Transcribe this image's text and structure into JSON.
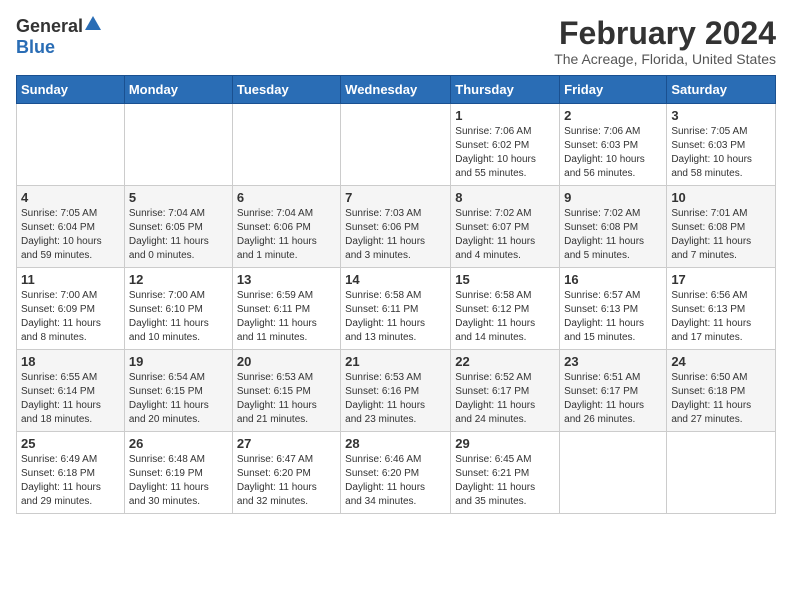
{
  "header": {
    "logo_general": "General",
    "logo_blue": "Blue",
    "title": "February 2024",
    "subtitle": "The Acreage, Florida, United States"
  },
  "weekdays": [
    "Sunday",
    "Monday",
    "Tuesday",
    "Wednesday",
    "Thursday",
    "Friday",
    "Saturday"
  ],
  "weeks": [
    [
      {
        "day": "",
        "content": ""
      },
      {
        "day": "",
        "content": ""
      },
      {
        "day": "",
        "content": ""
      },
      {
        "day": "",
        "content": ""
      },
      {
        "day": "1",
        "content": "Sunrise: 7:06 AM\nSunset: 6:02 PM\nDaylight: 10 hours\nand 55 minutes."
      },
      {
        "day": "2",
        "content": "Sunrise: 7:06 AM\nSunset: 6:03 PM\nDaylight: 10 hours\nand 56 minutes."
      },
      {
        "day": "3",
        "content": "Sunrise: 7:05 AM\nSunset: 6:03 PM\nDaylight: 10 hours\nand 58 minutes."
      }
    ],
    [
      {
        "day": "4",
        "content": "Sunrise: 7:05 AM\nSunset: 6:04 PM\nDaylight: 10 hours\nand 59 minutes."
      },
      {
        "day": "5",
        "content": "Sunrise: 7:04 AM\nSunset: 6:05 PM\nDaylight: 11 hours\nand 0 minutes."
      },
      {
        "day": "6",
        "content": "Sunrise: 7:04 AM\nSunset: 6:06 PM\nDaylight: 11 hours\nand 1 minute."
      },
      {
        "day": "7",
        "content": "Sunrise: 7:03 AM\nSunset: 6:06 PM\nDaylight: 11 hours\nand 3 minutes."
      },
      {
        "day": "8",
        "content": "Sunrise: 7:02 AM\nSunset: 6:07 PM\nDaylight: 11 hours\nand 4 minutes."
      },
      {
        "day": "9",
        "content": "Sunrise: 7:02 AM\nSunset: 6:08 PM\nDaylight: 11 hours\nand 5 minutes."
      },
      {
        "day": "10",
        "content": "Sunrise: 7:01 AM\nSunset: 6:08 PM\nDaylight: 11 hours\nand 7 minutes."
      }
    ],
    [
      {
        "day": "11",
        "content": "Sunrise: 7:00 AM\nSunset: 6:09 PM\nDaylight: 11 hours\nand 8 minutes."
      },
      {
        "day": "12",
        "content": "Sunrise: 7:00 AM\nSunset: 6:10 PM\nDaylight: 11 hours\nand 10 minutes."
      },
      {
        "day": "13",
        "content": "Sunrise: 6:59 AM\nSunset: 6:11 PM\nDaylight: 11 hours\nand 11 minutes."
      },
      {
        "day": "14",
        "content": "Sunrise: 6:58 AM\nSunset: 6:11 PM\nDaylight: 11 hours\nand 13 minutes."
      },
      {
        "day": "15",
        "content": "Sunrise: 6:58 AM\nSunset: 6:12 PM\nDaylight: 11 hours\nand 14 minutes."
      },
      {
        "day": "16",
        "content": "Sunrise: 6:57 AM\nSunset: 6:13 PM\nDaylight: 11 hours\nand 15 minutes."
      },
      {
        "day": "17",
        "content": "Sunrise: 6:56 AM\nSunset: 6:13 PM\nDaylight: 11 hours\nand 17 minutes."
      }
    ],
    [
      {
        "day": "18",
        "content": "Sunrise: 6:55 AM\nSunset: 6:14 PM\nDaylight: 11 hours\nand 18 minutes."
      },
      {
        "day": "19",
        "content": "Sunrise: 6:54 AM\nSunset: 6:15 PM\nDaylight: 11 hours\nand 20 minutes."
      },
      {
        "day": "20",
        "content": "Sunrise: 6:53 AM\nSunset: 6:15 PM\nDaylight: 11 hours\nand 21 minutes."
      },
      {
        "day": "21",
        "content": "Sunrise: 6:53 AM\nSunset: 6:16 PM\nDaylight: 11 hours\nand 23 minutes."
      },
      {
        "day": "22",
        "content": "Sunrise: 6:52 AM\nSunset: 6:17 PM\nDaylight: 11 hours\nand 24 minutes."
      },
      {
        "day": "23",
        "content": "Sunrise: 6:51 AM\nSunset: 6:17 PM\nDaylight: 11 hours\nand 26 minutes."
      },
      {
        "day": "24",
        "content": "Sunrise: 6:50 AM\nSunset: 6:18 PM\nDaylight: 11 hours\nand 27 minutes."
      }
    ],
    [
      {
        "day": "25",
        "content": "Sunrise: 6:49 AM\nSunset: 6:18 PM\nDaylight: 11 hours\nand 29 minutes."
      },
      {
        "day": "26",
        "content": "Sunrise: 6:48 AM\nSunset: 6:19 PM\nDaylight: 11 hours\nand 30 minutes."
      },
      {
        "day": "27",
        "content": "Sunrise: 6:47 AM\nSunset: 6:20 PM\nDaylight: 11 hours\nand 32 minutes."
      },
      {
        "day": "28",
        "content": "Sunrise: 6:46 AM\nSunset: 6:20 PM\nDaylight: 11 hours\nand 34 minutes."
      },
      {
        "day": "29",
        "content": "Sunrise: 6:45 AM\nSunset: 6:21 PM\nDaylight: 11 hours\nand 35 minutes."
      },
      {
        "day": "",
        "content": ""
      },
      {
        "day": "",
        "content": ""
      }
    ]
  ]
}
